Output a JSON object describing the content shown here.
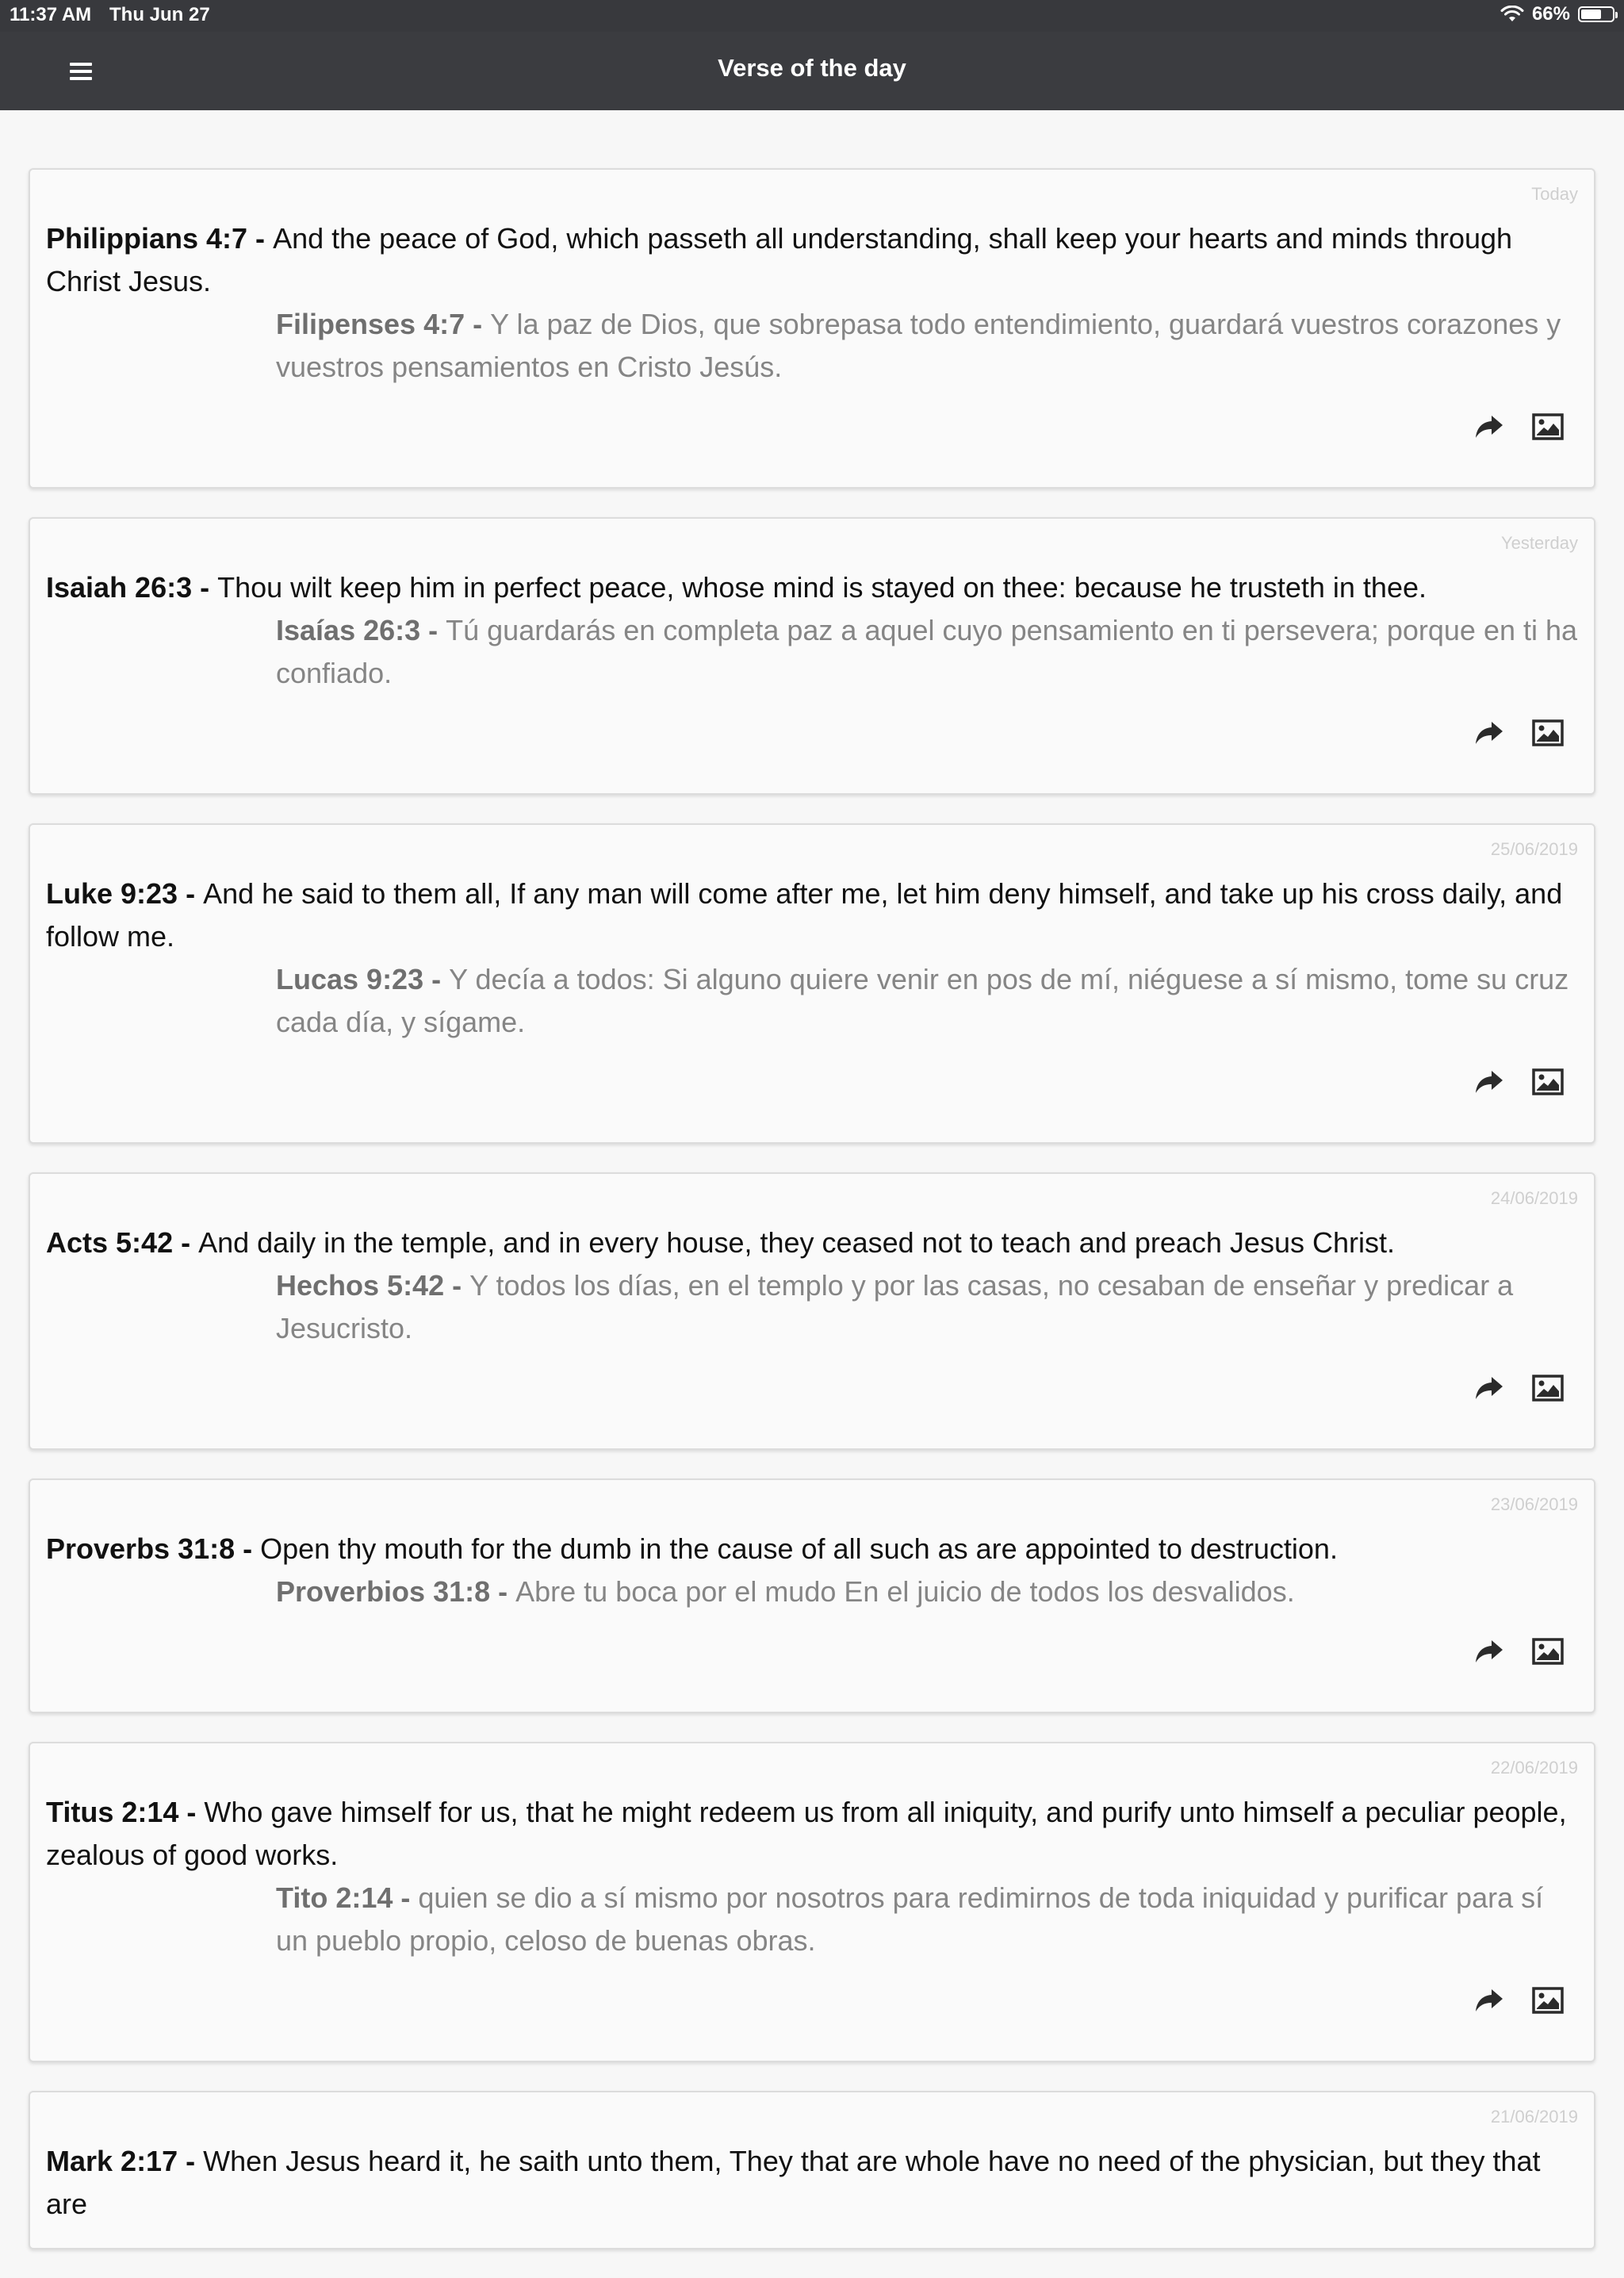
{
  "status_bar": {
    "time": "11:37 AM",
    "date": "Thu Jun 27",
    "battery_text": "66%",
    "battery_level": 0.66
  },
  "nav": {
    "title": "Verse of the day",
    "menu_icon": "hamburger-menu-icon"
  },
  "verses": [
    {
      "date": "Today",
      "en_ref": "Philippians 4:7 - ",
      "en_text": "And the peace of God, which passeth all understanding, shall keep your hearts and minds through Christ Jesus.",
      "es_ref": "Filipenses 4:7 - ",
      "es_text": "Y la paz de Dios, que sobrepasa todo entendimiento, guardará vuestros corazones y vuestros pensamientos en Cristo Jesús."
    },
    {
      "date": "Yesterday",
      "en_ref": "Isaiah 26:3 - ",
      "en_text": "Thou wilt keep him in perfect peace, whose mind is stayed on thee: because he trusteth in thee.",
      "es_ref": "Isaías 26:3 - ",
      "es_text": "Tú guardarás en completa paz a aquel cuyo pensamiento en ti persevera; porque en ti ha confiado."
    },
    {
      "date": "25/06/2019",
      "en_ref": "Luke 9:23 - ",
      "en_text": "And he said to them all, If any man will come after me, let him deny himself, and take up his cross daily, and follow me.",
      "es_ref": "Lucas 9:23 - ",
      "es_text": "Y decía a todos: Si alguno quiere venir en pos de mí, niéguese a sí mismo, tome su cruz cada día, y sígame."
    },
    {
      "date": "24/06/2019",
      "en_ref": "Acts 5:42 - ",
      "en_text": "And daily in the temple, and in every house, they ceased not to teach and preach Jesus Christ.",
      "es_ref": "Hechos 5:42 - ",
      "es_text": "Y todos los días, en el templo y por las casas, no cesaban de enseñar y predicar a Jesucristo."
    },
    {
      "date": "23/06/2019",
      "en_ref": "Proverbs 31:8 - ",
      "en_text": "Open thy mouth for the dumb in the cause of all such as are appointed to destruction.",
      "es_ref": "Proverbios 31:8 - ",
      "es_text": "Abre tu boca por el mudo En el juicio de todos los desvalidos."
    },
    {
      "date": "22/06/2019",
      "en_ref": "Titus 2:14 - ",
      "en_text": "Who gave himself for us, that he might redeem us from all iniquity, and purify unto himself a peculiar people, zealous of good works.",
      "es_ref": "Tito 2:14 - ",
      "es_text": "quien se dio a sí mismo por nosotros para redimirnos de toda iniquidad y purificar para sí un pueblo propio, celoso de buenas obras."
    },
    {
      "date": "21/06/2019",
      "en_ref": "Mark 2:17 - ",
      "en_text": "When Jesus heard it, he saith unto them, They that are whole have no need of the physician, but they that are"
    }
  ],
  "actions": {
    "share_icon": "share-icon",
    "image_icon": "image-icon"
  },
  "colors": {
    "nav_background": "#3b3c40",
    "page_background": "#f7f7f7",
    "card_background": "#fafafa",
    "english_text": "#111111",
    "spanish_text": "#858585"
  }
}
